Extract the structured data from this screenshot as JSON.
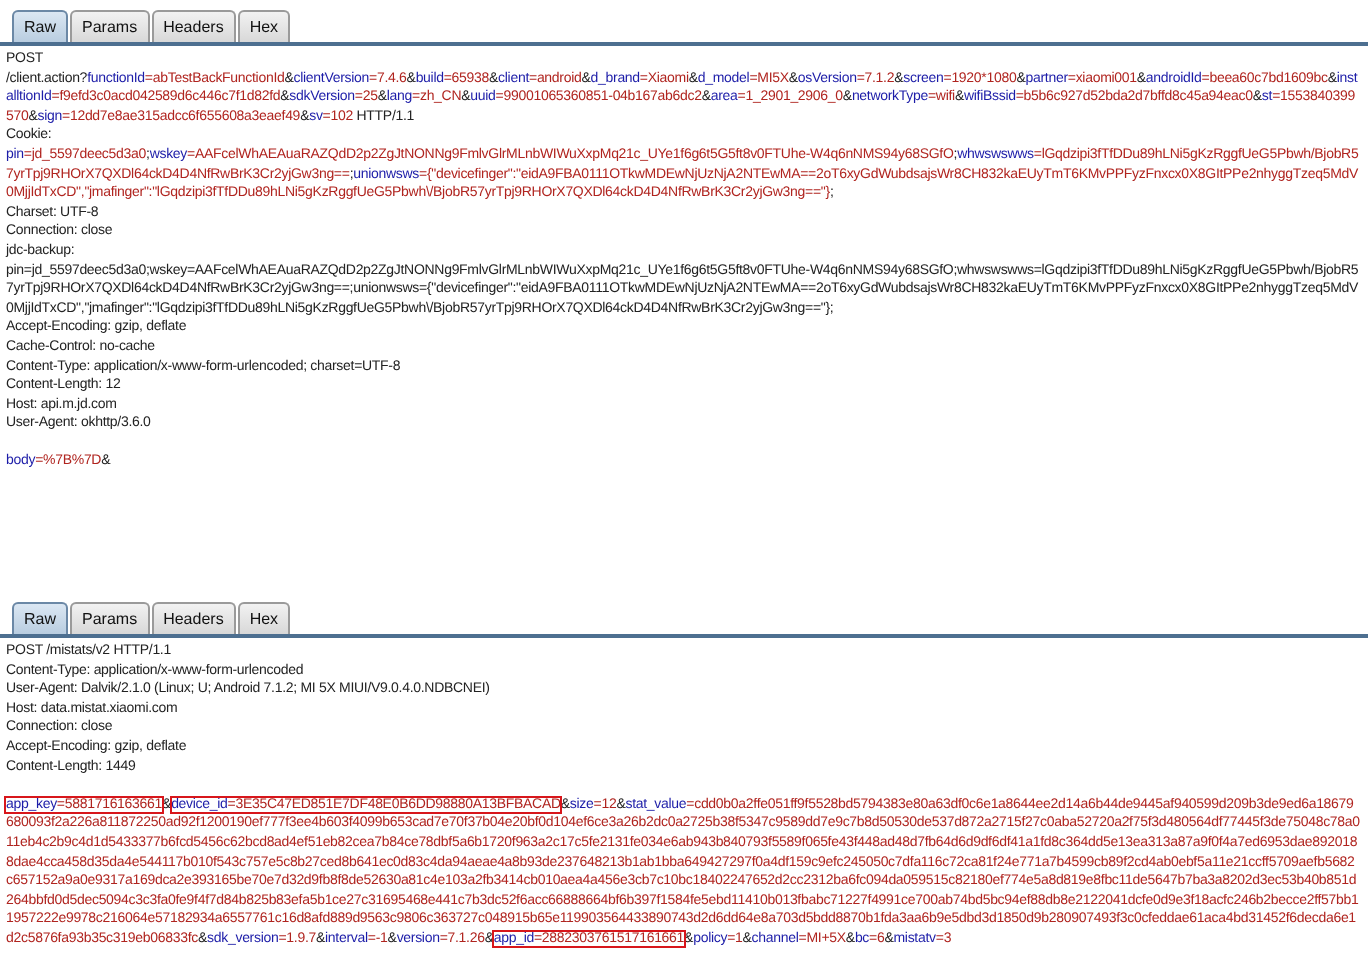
{
  "panels": [
    {
      "tabs": [
        {
          "label": "Raw",
          "selected": true
        },
        {
          "label": "Params",
          "selected": false
        },
        {
          "label": "Headers",
          "selected": false
        },
        {
          "label": "Hex",
          "selected": false
        }
      ],
      "sections": [
        {
          "lines": [
            {
              "parts": [
                {
                  "kind": "text",
                  "text": "POST"
                }
              ]
            },
            {
              "parts": [
                {
                  "kind": "text",
                  "text": "/client.action?"
                },
                {
                  "kind": "param",
                  "key": "functionId",
                  "value": "=abTestBackFunctionId",
                  "sep": "&",
                  "boxed": false
                },
                {
                  "kind": "param",
                  "key": "clientVersion",
                  "value": "=7.4.6",
                  "sep": "&",
                  "boxed": false
                },
                {
                  "kind": "param",
                  "key": "build",
                  "value": "=65938",
                  "sep": "&",
                  "boxed": false
                },
                {
                  "kind": "param",
                  "key": "client",
                  "value": "=android",
                  "sep": "&",
                  "boxed": false
                },
                {
                  "kind": "param",
                  "key": "d_brand",
                  "value": "=Xiaomi",
                  "sep": "&",
                  "boxed": false
                },
                {
                  "kind": "param",
                  "key": "d_model",
                  "value": "=MI5X",
                  "sep": "&",
                  "boxed": false
                },
                {
                  "kind": "param",
                  "key": "osVersion",
                  "value": "=7.1.2",
                  "sep": "&",
                  "boxed": false
                },
                {
                  "kind": "param",
                  "key": "screen",
                  "value": "=1920*1080",
                  "sep": "&",
                  "boxed": false
                },
                {
                  "kind": "param",
                  "key": "partner",
                  "value": "=xiaomi001",
                  "sep": "&",
                  "boxed": false
                },
                {
                  "kind": "param",
                  "key": "androidId",
                  "value": "=beea60c7bd1609bc",
                  "sep": "&",
                  "boxed": false
                },
                {
                  "kind": "param",
                  "key": "installtionId",
                  "value": "=f9efd3c0acd042589d6c446c7f1d82fd",
                  "sep": "&",
                  "boxed": false
                },
                {
                  "kind": "param",
                  "key": "sdkVersion",
                  "value": "=25",
                  "sep": "&",
                  "boxed": false
                },
                {
                  "kind": "param",
                  "key": "lang",
                  "value": "=zh_CN",
                  "sep": "&",
                  "boxed": false
                },
                {
                  "kind": "param",
                  "key": "uuid",
                  "value": "=99001065360851-04b167ab6dc2",
                  "sep": "&",
                  "boxed": false
                },
                {
                  "kind": "param",
                  "key": "area",
                  "value": "=1_2901_2906_0",
                  "sep": "&",
                  "boxed": false
                },
                {
                  "kind": "param",
                  "key": "networkType",
                  "value": "=wifi",
                  "sep": "&",
                  "boxed": false
                },
                {
                  "kind": "param",
                  "key": "wifiBssid",
                  "value": "=b5b6c927d52bda2d7bffd8c45a94eac0",
                  "sep": "&",
                  "boxed": false
                },
                {
                  "kind": "param",
                  "key": "st",
                  "value": "=1553840399570",
                  "sep": "&",
                  "boxed": false
                },
                {
                  "kind": "param",
                  "key": "sign",
                  "value": "=12dd7e8ae315adcc6f655608a3eaef49",
                  "sep": "&",
                  "boxed": false
                },
                {
                  "kind": "param",
                  "key": "sv",
                  "value": "=102",
                  "boxed": false
                },
                {
                  "kind": "text",
                  "text": " HTTP/1.1"
                }
              ]
            },
            {
              "parts": [
                {
                  "kind": "text",
                  "text": "Cookie:"
                }
              ]
            },
            {
              "parts": [
                {
                  "kind": "param",
                  "key": "pin",
                  "value": "=jd_5597deec5d3a0",
                  "sep": ";",
                  "boxed": false
                },
                {
                  "kind": "param",
                  "key": "wskey",
                  "value": "=AAFcelWhAEAuaRAZQdD2p2ZgJtNONNg9FmlvGlrMLnbWIWuXxpMq21c_UYe1f6g6t5G5ft8v0FTUhe-W4q6nNMS94y68SGfO",
                  "sep": ";",
                  "boxed": false
                },
                {
                  "kind": "param",
                  "key": "whwswswws",
                  "value": "=lGqdzipi3fTfDDu89hLNi5gKzRggfUeG5Pbwh/BjobR57yrTpj9RHOrX7QXDl64ckD4D4NfRwBrK3Cr2yjGw3ng==",
                  "sep": ";",
                  "boxed": false
                },
                {
                  "kind": "param",
                  "key": "unionwsws",
                  "value": "={\"devicefinger\":\"eidA9FBA0111OTkwMDEwNjUzNjA2NTEwMA==2oT6xyGdWubdsajsWr8CH832kaEUyTmT6KMvPPFyzFnxcx0X8GItPPe2nhyggTzeq5MdV0MjjIdTxCD\",\"jmafinger\":\"lGqdzipi3fTfDDu89hLNi5gKzRggfUeG5Pbwh\\/BjobR57yrTpj9RHOrX7QXDl64ckD4D4NfRwBrK3Cr2yjGw3ng==\"}",
                  "sep": ";",
                  "boxed": false
                }
              ]
            },
            {
              "parts": [
                {
                  "kind": "text",
                  "text": "Charset: UTF-8"
                }
              ]
            },
            {
              "parts": [
                {
                  "kind": "text",
                  "text": "Connection: close"
                }
              ]
            },
            {
              "parts": [
                {
                  "kind": "text",
                  "text": "jdc-backup:"
                }
              ]
            },
            {
              "parts": [
                {
                  "kind": "text",
                  "text": "pin=jd_5597deec5d3a0;wskey=AAFcelWhAEAuaRAZQdD2p2ZgJtNONNg9FmlvGlrMLnbWIWuXxpMq21c_UYe1f6g6t5G5ft8v0FTUhe-W4q6nNMS94y68SGfO;whwswswws=lGqdzipi3fTfDDu89hLNi5gKzRggfUeG5Pbwh/BjobR57yrTpj9RHOrX7QXDl64ckD4D4NfRwBrK3Cr2yjGw3ng==;unionwsws={\"devicefinger\":\"eidA9FBA0111OTkwMDEwNjUzNjA2NTEwMA==2oT6xyGdWubdsajsWr8CH832kaEUyTmT6KMvPPFyzFnxcx0X8GItPPe2nhyggTzeq5MdV0MjjIdTxCD\",\"jmafinger\":\"lGqdzipi3fTfDDu89hLNi5gKzRggfUeG5Pbwh\\/BjobR57yrTpj9RHOrX7QXDl64ckD4D4NfRwBrK3Cr2yjGw3ng==\"};"
                }
              ]
            },
            {
              "parts": [
                {
                  "kind": "text",
                  "text": "Accept-Encoding: gzip, deflate"
                }
              ]
            },
            {
              "parts": [
                {
                  "kind": "text",
                  "text": "Cache-Control: no-cache"
                }
              ]
            },
            {
              "parts": [
                {
                  "kind": "text",
                  "text": "Content-Type: application/x-www-form-urlencoded; charset=UTF-8"
                }
              ]
            },
            {
              "parts": [
                {
                  "kind": "text",
                  "text": "Content-Length: 12"
                }
              ]
            },
            {
              "parts": [
                {
                  "kind": "text",
                  "text": "Host: api.m.jd.com"
                }
              ]
            },
            {
              "parts": [
                {
                  "kind": "text",
                  "text": "User-Agent: okhttp/3.6.0"
                }
              ]
            }
          ]
        },
        {
          "lines": [
            {
              "parts": [
                {
                  "kind": "param",
                  "key": "body",
                  "value": "=%7B%7D",
                  "sep": "&",
                  "boxed": false
                }
              ]
            }
          ]
        }
      ]
    },
    {
      "tabs": [
        {
          "label": "Raw",
          "selected": true
        },
        {
          "label": "Params",
          "selected": false
        },
        {
          "label": "Headers",
          "selected": false
        },
        {
          "label": "Hex",
          "selected": false
        }
      ],
      "sections": [
        {
          "lines": [
            {
              "parts": [
                {
                  "kind": "text",
                  "text": "POST /mistats/v2 HTTP/1.1"
                }
              ]
            },
            {
              "parts": [
                {
                  "kind": "text",
                  "text": "Content-Type: application/x-www-form-urlencoded"
                }
              ]
            },
            {
              "parts": [
                {
                  "kind": "text",
                  "text": "User-Agent: Dalvik/2.1.0 (Linux; U; Android 7.1.2; MI 5X MIUI/V9.0.4.0.NDBCNEI)"
                }
              ]
            },
            {
              "parts": [
                {
                  "kind": "text",
                  "text": "Host: data.mistat.xiaomi.com"
                }
              ]
            },
            {
              "parts": [
                {
                  "kind": "text",
                  "text": "Connection: close"
                }
              ]
            },
            {
              "parts": [
                {
                  "kind": "text",
                  "text": "Accept-Encoding: gzip, deflate"
                }
              ]
            },
            {
              "parts": [
                {
                  "kind": "text",
                  "text": "Content-Length: 1449"
                }
              ]
            }
          ]
        },
        {
          "lines": [
            {
              "parts": [
                {
                  "kind": "param",
                  "key": "app_key",
                  "value": "=5881716163661",
                  "sep": "&",
                  "boxed": true
                },
                {
                  "kind": "param",
                  "key": "device_id",
                  "value": "=3E35C47ED851E7DF48E0B6DD98880A13BFBACAD",
                  "sep": "&",
                  "boxed": true
                },
                {
                  "kind": "param",
                  "key": "size",
                  "value": "=12",
                  "sep": "&",
                  "boxed": false
                },
                {
                  "kind": "param",
                  "key": "stat_value",
                  "value": "=cdd0b0a2ffe051ff9f5528bd5794383e80a63df0c6e1a8644ee2d14a6b44de9445af940599d209b3de9ed6a18679680093f2a226a811872250ad92f1200190ef777f3ee4b603f4099b653cad7e70f37b04e20bf0d104ef6ce3a26b2dc0a2725b38f5347c9589dd7e9c7b8d50530de537d872a2715f27c0aba52720a2f75f3d480564df77445f3de75048c78a011eb4c2b9c4d1d5433377b6fcd5456c62bcd8ad4ef51eb82cea7b84ce78dbf5a6b1720f963a2c17c5fe2131fe034e6ab943b840793f5589f065fe43f448ad48d7fb64d6d9df6df41a1fd8c364dd5e13ea313a87a9f0f4a7ed6953dae8920188dae4cca458d35da4e544117b010f543c757e5c8b27ced8b641ec0d83c4da94aeae4a8b93de237648213b1ab1bba649427297f0a4df159c9efc245050c7dfa116c72ca81f24e771a7b4599cb89f2cd4ab0ebf5a11e21ccff5709aefb5682c657152a9a0e9317a169dca2e393165be70e7d32d9fb8f8de52630a81c4e103a2fb3414cb010aea4a456e3cb7c10bc18402247652d2cc2312ba6fc094da059515c82180ef774e5a8d819e8fbc11de5647b7ba3a8202d3ec53b40b851d264bbfd0d5dec5094c3c3fa0fe9f4f7d84b825b83efa5b1ce27c31695468e441c7b3dc52f6acc66888664bf6b397f1584fe5ebd11410b013fbabc71227f4991ce700ab74bd5bc94ef88db8e2122041dcfe0d9e3f18acfc246b2becce2ff57bb11957222e9978c216064e57182934a6557761c16d8afd889d9563c9806c363727c048915b65e119903564433890743d2d6dd64e8a703d5bdd8870b1fda3aa6b9e5dbd3d1850d9b280907493f3c0cfeddae61aca4bd31452f6decda6e1d2c5876fa93b35c319eb06833fc",
                  "sep": "&",
                  "boxed": false
                },
                {
                  "kind": "param",
                  "key": "sdk_version",
                  "value": "=1.9.7",
                  "sep": "&",
                  "boxed": false
                },
                {
                  "kind": "param",
                  "key": "interval",
                  "value": "=-1",
                  "sep": "&",
                  "boxed": false
                },
                {
                  "kind": "param",
                  "key": "version",
                  "value": "=7.1.26",
                  "sep": "&",
                  "boxed": false
                },
                {
                  "kind": "param",
                  "key": "app_id",
                  "value": "=2882303761517161661",
                  "sep": "&",
                  "boxed": true
                },
                {
                  "kind": "param",
                  "key": "policy",
                  "value": "=1",
                  "sep": "&",
                  "boxed": false
                },
                {
                  "kind": "param",
                  "key": "channel",
                  "value": "=MI+5X",
                  "sep": "&",
                  "boxed": false
                },
                {
                  "kind": "param",
                  "key": "bc",
                  "value": "=6",
                  "sep": "&",
                  "boxed": false
                },
                {
                  "kind": "param",
                  "key": "mistatv",
                  "value": "=3",
                  "boxed": false
                }
              ]
            }
          ]
        }
      ]
    }
  ]
}
